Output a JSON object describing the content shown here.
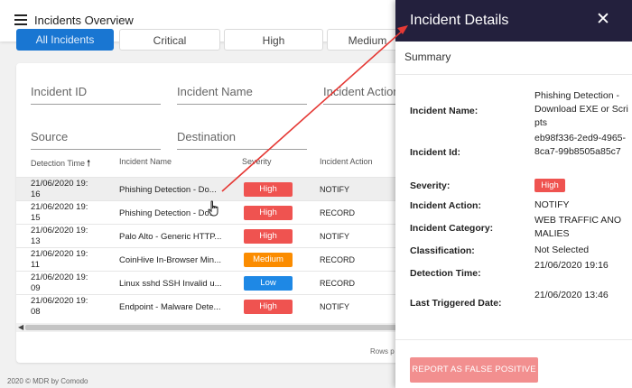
{
  "header": {
    "title": "Incidents Overview",
    "menu_icon": "hamburger-icon"
  },
  "filters": {
    "buttons": [
      "All Incidents",
      "Critical",
      "High",
      "Medium"
    ]
  },
  "search_fields": {
    "incident_id": "Incident ID",
    "incident_name": "Incident Name",
    "incident_action": "Incident Action",
    "source": "Source",
    "destination": "Destination"
  },
  "table": {
    "columns": [
      "Detection Time",
      "Incident Name",
      "Severity",
      "Incident Action"
    ],
    "sort_icon": "arrow-up-icon",
    "rows": [
      {
        "time": "21/06/2020 19:\n16",
        "name": "Phishing Detection - Do...",
        "severity": "High",
        "severity_color": "#ef5350",
        "action": "NOTIFY"
      },
      {
        "time": "21/06/2020 19:\n15",
        "name": "Phishing Detection - Do...",
        "severity": "High",
        "severity_color": "#ef5350",
        "action": "RECORD"
      },
      {
        "time": "21/06/2020 19:\n13",
        "name": "Palo Alto - Generic HTTP...",
        "severity": "High",
        "severity_color": "#ef5350",
        "action": "NOTIFY"
      },
      {
        "time": "21/06/2020 19:\n11",
        "name": "CoinHive In-Browser Min...",
        "severity": "Medium",
        "severity_color": "#fb8c00",
        "action": "RECORD"
      },
      {
        "time": "21/06/2020 19:\n09",
        "name": "Linux sshd SSH Invalid u...",
        "severity": "Low",
        "severity_color": "#1e88e5",
        "action": "RECORD"
      },
      {
        "time": "21/06/2020 19:\n08",
        "name": "Endpoint - Malware Dete...",
        "severity": "High",
        "severity_color": "#ef5350",
        "action": "NOTIFY"
      }
    ],
    "rows_per_page_label": "Rows p"
  },
  "footer": "2020 © MDR by Comodo",
  "drawer": {
    "title": "Incident Details",
    "close_icon": "close-icon",
    "section": "Summary",
    "fields": [
      {
        "label": "Incident Name:",
        "value": "Phishing Detection - Download EXE or Scripts"
      },
      {
        "label": "Incident Id:",
        "value": "eb98f336-2ed9-4965-8ca7-99b8505a85c7"
      },
      {
        "label": "Severity:",
        "value": "High"
      },
      {
        "label": "Incident Action:",
        "value": "NOTIFY"
      },
      {
        "label": "Incident Category:",
        "value": "WEB TRAFFIC ANOMALIES"
      },
      {
        "label": "Classification:",
        "value": "Not Selected"
      },
      {
        "label": "Detection Time:",
        "value": "21/06/2020 19:16"
      },
      {
        "label": "Last Triggered Date:",
        "value": "21/06/2020 13:46"
      }
    ],
    "false_positive_button": "REPORT AS FALSE POSITIVE"
  },
  "colors": {
    "primary": "#1976d2",
    "drawer_header": "#23203d",
    "high": "#ef5350",
    "medium": "#fb8c00",
    "low": "#1e88e5",
    "annotation_arrow": "#e53935"
  }
}
